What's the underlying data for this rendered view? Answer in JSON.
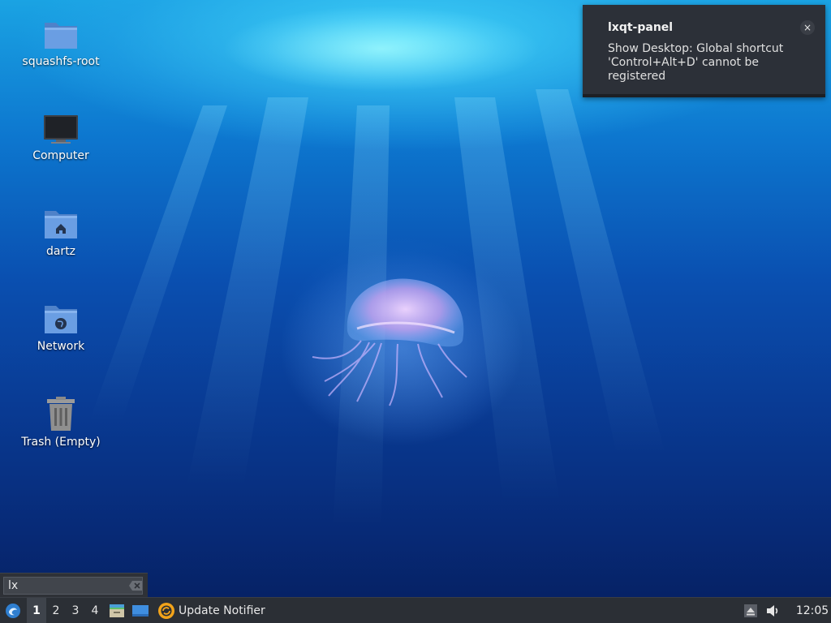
{
  "desktop": {
    "icons": [
      {
        "label": "squashfs-root",
        "icon": "folder-icon"
      },
      {
        "label": "Computer",
        "icon": "computer-icon"
      },
      {
        "label": "dartz",
        "icon": "home-folder-icon"
      },
      {
        "label": "Network",
        "icon": "network-folder-icon"
      },
      {
        "label": "Trash (Empty)",
        "icon": "trash-icon"
      }
    ]
  },
  "notification": {
    "title": "lxqt-panel",
    "body": "Show Desktop: Global shortcut 'Control+Alt+D' cannot be registered",
    "close_label": "×"
  },
  "search": {
    "value": "lx",
    "clear_icon": "clear-text-icon"
  },
  "taskbar": {
    "start_icon": "lxqt-menu-icon",
    "workspaces": [
      "1",
      "2",
      "3",
      "4"
    ],
    "active_workspace": "1",
    "quicklaunch": [
      "file-manager-icon",
      "show-desktop-icon"
    ],
    "task_label": "Update Notifier",
    "task_icon": "update-notifier-icon",
    "tray": [
      "removable-media-icon",
      "volume-icon"
    ],
    "clock": "12:05"
  },
  "colors": {
    "panel": "#2b2f35",
    "notification_bg": "#2c3038",
    "desktop_top": "#1aa3e3",
    "desktop_bottom": "#061f5f",
    "folder": "#5b8fd6"
  }
}
